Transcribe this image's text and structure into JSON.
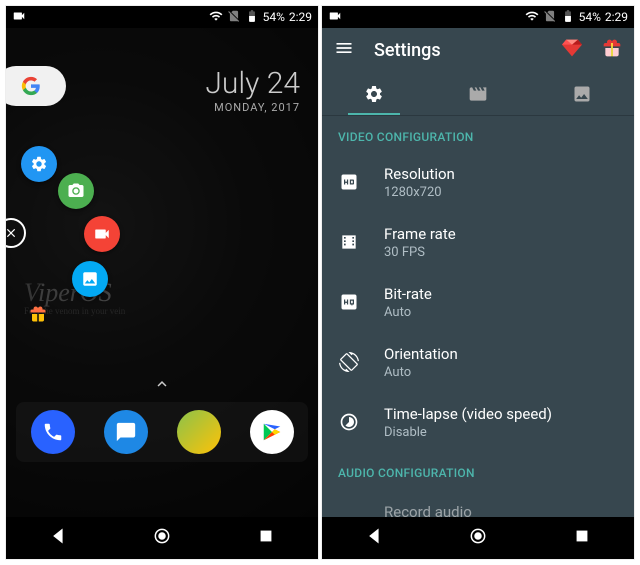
{
  "status": {
    "battery_pct": "54%",
    "time": "2:29"
  },
  "home": {
    "date_big": "July 24",
    "date_small": "MONDAY, 2017",
    "wallpaper_brand": "ViperOS",
    "wallpaper_tagline": "Feel the venom in your vein"
  },
  "settings": {
    "title": "Settings",
    "section_video": "VIDEO CONFIGURATION",
    "section_audio": "AUDIO CONFIGURATION",
    "items": [
      {
        "label": "Resolution",
        "value": "1280x720"
      },
      {
        "label": "Frame rate",
        "value": "30 FPS"
      },
      {
        "label": "Bit-rate",
        "value": "Auto"
      },
      {
        "label": "Orientation",
        "value": "Auto"
      },
      {
        "label": "Time-lapse (video speed)",
        "value": "Disable"
      }
    ],
    "audio_item_label": "Record audio"
  }
}
